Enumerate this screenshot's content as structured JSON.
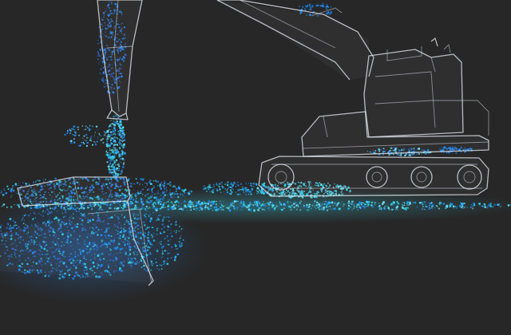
{
  "scene": {
    "background": "#272727",
    "machine": "excavator",
    "rendering": "wireframe",
    "material": "particle-soil",
    "particle_colors": [
      "#1f8fff",
      "#2fd0e6",
      "#6fe6ff",
      "#3a6fd8"
    ],
    "wire_color": "#e6e9ee"
  }
}
